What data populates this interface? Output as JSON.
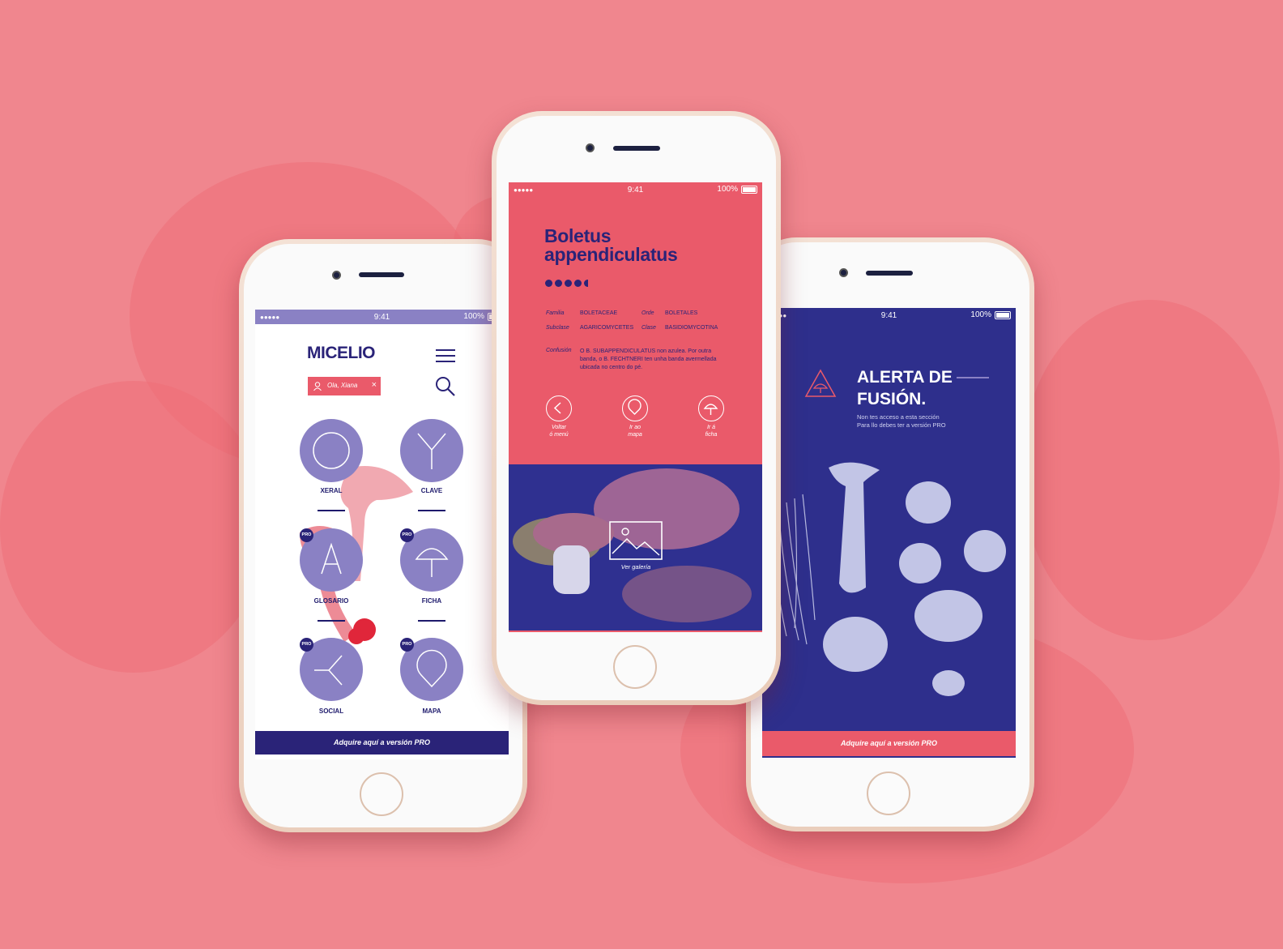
{
  "theme": {
    "background": "#f0868e",
    "accent_pink": "#ea5a6a",
    "navy": "#2a2378",
    "lilac": "#8a81c4"
  },
  "status_bar": {
    "time": "9:41",
    "battery": "100%",
    "signal": "●●●●●"
  },
  "phone_left": {
    "app_title": "MICELIO",
    "greeting": "Ola, Xiana",
    "categories": [
      {
        "label": "XERAL",
        "icon": "circle-icon",
        "pro": false
      },
      {
        "label": "CLAVE",
        "icon": "y-branch-icon",
        "pro": false
      },
      {
        "label": "GLOSARIO",
        "icon": "letter-a-icon",
        "pro": true
      },
      {
        "label": "FICHA",
        "icon": "mushroom-icon",
        "pro": true
      },
      {
        "label": "SOCIAL",
        "icon": "fork-icon",
        "pro": true
      },
      {
        "label": "MAPA",
        "icon": "map-pin-icon",
        "pro": true
      }
    ],
    "pro_badge": "PRO",
    "cta": "Adquire aquí a versión PRO"
  },
  "phone_center": {
    "species_line1": "Boletus",
    "species_line2": "appendiculatus",
    "meta": {
      "familia_label": "Familia",
      "familia_value": "BOLETACEAE",
      "orde_label": "Orde",
      "orde_value": "BOLETALES",
      "subclase_label": "Subclase",
      "subclase_value": "AGARICOMYCETES",
      "clase_label": "Clase",
      "clase_value": "BASIDIOMYCOTINA",
      "confusion_label": "Confusión",
      "confusion_value_1": "O B. SUBAPPENDICULATUS non azulea. Por outra",
      "confusion_value_2": "banda, o B. FECHTNERI ten unha banda avermellada",
      "confusion_value_3": "ubicada no centro do pé."
    },
    "nav": [
      {
        "line1": "Voltar",
        "line2": "ó menú",
        "icon": "back-icon"
      },
      {
        "line1": "Ir ao",
        "line2": "mapa",
        "icon": "map-pin-icon"
      },
      {
        "line1": "Ir á",
        "line2": "ficha",
        "icon": "mushroom-icon"
      }
    ],
    "gallery_label": "Ver galería"
  },
  "phone_right": {
    "alert_line1": "ALERTA DE",
    "alert_line2": "FUSIÓN.",
    "alert_sub_1": "Non tes acceso a esta sección",
    "alert_sub_2": "Para llo debes ter a versión PRO",
    "cta": "Adquire aquí a versión PRO"
  }
}
